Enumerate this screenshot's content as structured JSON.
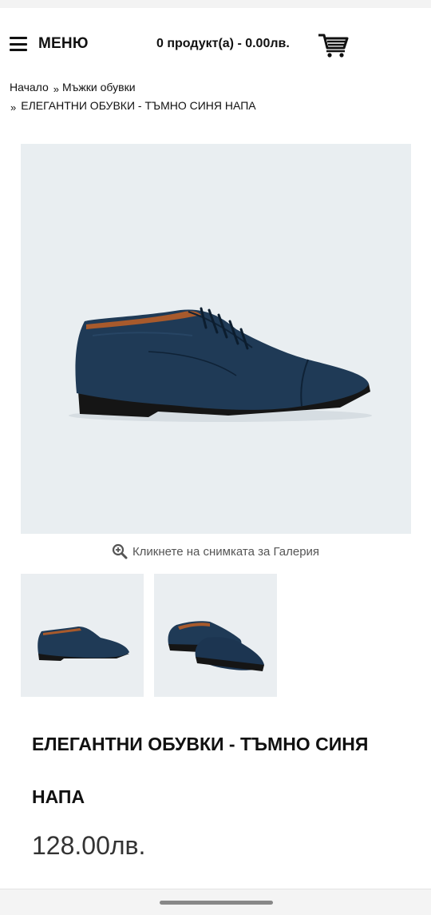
{
  "header": {
    "menu_label": "МЕНЮ",
    "cart_text": "0 продукт(а) - 0.00лв."
  },
  "breadcrumb": {
    "home": "Начало",
    "separator": "»",
    "category": "Мъжки обувки",
    "current": "ЕЛЕГАНТНИ ОБУВКИ - ТЪМНО СИНЯ НАПА"
  },
  "gallery": {
    "hint": "Кликнете на снимката за Галерия"
  },
  "product": {
    "title_line1": "ЕЛЕГАНТНИ ОБУВКИ - ТЪМНО СИНЯ",
    "title_line2": "НАПА",
    "price": "128.00лв."
  },
  "colors": {
    "shoe_leather": "#1f3a56",
    "sole": "#151515",
    "lining": "#a85a2c",
    "image_bg": "#e9eef1"
  },
  "icons": [
    "hamburger-icon",
    "cart-icon",
    "zoom-in-icon"
  ]
}
